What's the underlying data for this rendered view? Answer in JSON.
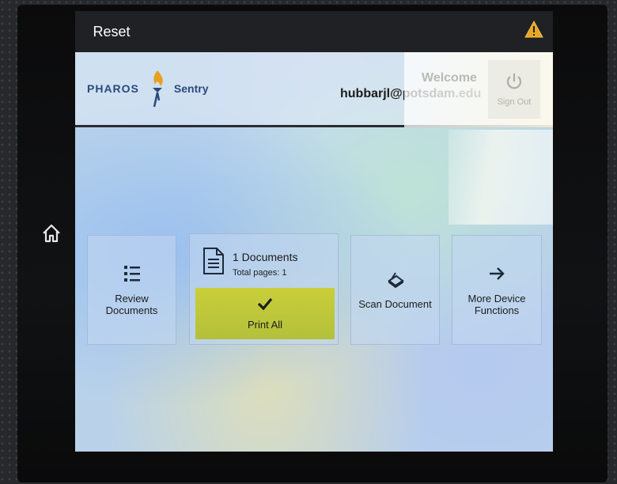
{
  "topbar": {
    "reset_label": "Reset",
    "warning_icon": "warning-triangle-icon"
  },
  "header": {
    "logo_left": "PHAROS",
    "logo_right": "Sentry",
    "user_email": "hubbarjl@potsdam.edu",
    "welcome": "Welcome",
    "sign_out_label": "Sign Out"
  },
  "tiles": {
    "review": {
      "label_line1": "Review",
      "label_line2": "Documents",
      "icon": "list-icon"
    },
    "documents": {
      "count_label": "1 Documents",
      "pages_label": "Total pages: 1",
      "icon": "document-icon"
    },
    "print": {
      "label": "Print All",
      "icon": "checkmark-icon"
    },
    "scan": {
      "label": "Scan Document",
      "icon": "scanner-icon"
    },
    "more": {
      "label_line1": "More Device",
      "label_line2": "Functions",
      "icon": "arrow-right-icon"
    }
  },
  "colors": {
    "print_button": "#c4cb3a",
    "topbar": "#1f2124",
    "logo": "#2a4a7a",
    "flame": "#e8a020"
  }
}
